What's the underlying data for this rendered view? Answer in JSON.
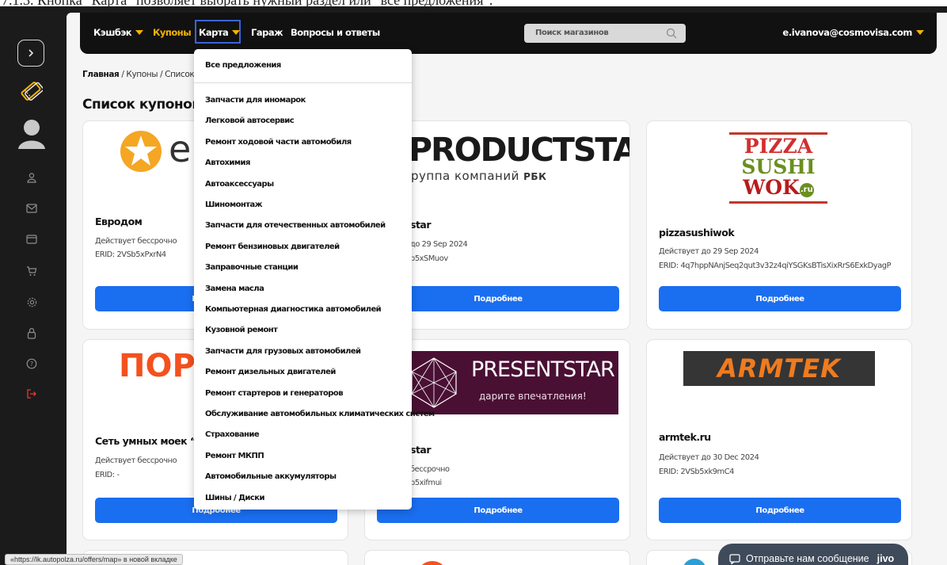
{
  "caption": "7.1.3. Кнопка \"Карта\" позволяет выбрать нужный раздел или \"все предложения\".",
  "header": {
    "nav": {
      "cashback": "Кэшбэк",
      "coupons": "Купоны",
      "map": "Карта",
      "garage": "Гараж",
      "faq": "Вопросы и ответы"
    },
    "search_placeholder": "Поиск магазинов",
    "user_email": "e.ivanova@cosmovisa.com"
  },
  "breadcrumb": {
    "home": "Главная",
    "sep": " / ",
    "coupons": "Купоны",
    "current": "Список"
  },
  "page_title": "Список купонов",
  "cards": [
    {
      "name": "Евродом",
      "valid": "Действует бессрочно",
      "erid": "ERID: 2VSb5xPxrN4",
      "button": "Подробнее",
      "logo_text": "er"
    },
    {
      "name": "star",
      "valid": "до 29 Sep 2024",
      "erid": "b5xSMuov",
      "button": "Подробнее",
      "logo_text": "PRODUCTSTAR",
      "logo_sub": "руппа компаний",
      "logo_rbk": "РБК"
    },
    {
      "name": "pizzasushiwok",
      "valid": "Действует до 29 Sep 2024",
      "erid": "ERID: 4q7hppNAnjSeq2qut3v32z4qiYSGKsBTisXixRrS6ExkDyagP",
      "button": "Подробнее",
      "logo_lines": [
        "PIZZA",
        "SUSHI",
        "WOK"
      ],
      "logo_ru": ".ru"
    },
    {
      "name": "Сеть умных моек “По",
      "valid": "Действует бессрочно",
      "erid": "ERID: -",
      "button": "Подробнее",
      "logo_text": "ПОР"
    },
    {
      "name": "star",
      "valid": "бессрочно",
      "erid": "b5xifmui",
      "button": "Подробнее",
      "logo_text": "PRESENTSTAR",
      "logo_sub": "дарите впечатления!"
    },
    {
      "name": "armtek.ru",
      "valid": "Действует до 30 Dec 2024",
      "erid": "ERID: 2VSb5xk9mC4",
      "button": "Подробнее",
      "logo_text": "ARMTEK"
    }
  ],
  "dropdown": {
    "all": "Все предложения",
    "items": [
      "Запчасти для иномарок",
      "Легковой автосервис",
      "Ремонт ходовой части автомобиля",
      "Автохимия",
      "Автоаксессуары",
      "Шиномонтаж",
      "Запчасти для отечественных автомобилей",
      "Ремонт бензиновых двигателей",
      "Заправочные станции",
      "Замена масла",
      "Компьютерная диагностика автомобилей",
      "Кузовной ремонт",
      "Запчасти для грузовых автомобилей",
      "Ремонт дизельных двигателей",
      "Ремонт стартеров и генераторов",
      "Обслуживание автомобильных климатических систем",
      "Страхование",
      "Ремонт МКПП",
      "Автомобильные аккумуляторы",
      "Шины / Диски"
    ]
  },
  "status_url": "«https://lk.autopolza.ru/offers/map» в новой вкладке",
  "chat": {
    "text": "Отправьте нам сообщение",
    "brand": "jivo"
  },
  "colors": {
    "accent": "#f5b301",
    "primary_button": "#1a6ef0",
    "topbar": "#111111",
    "logout": "#e53935"
  }
}
